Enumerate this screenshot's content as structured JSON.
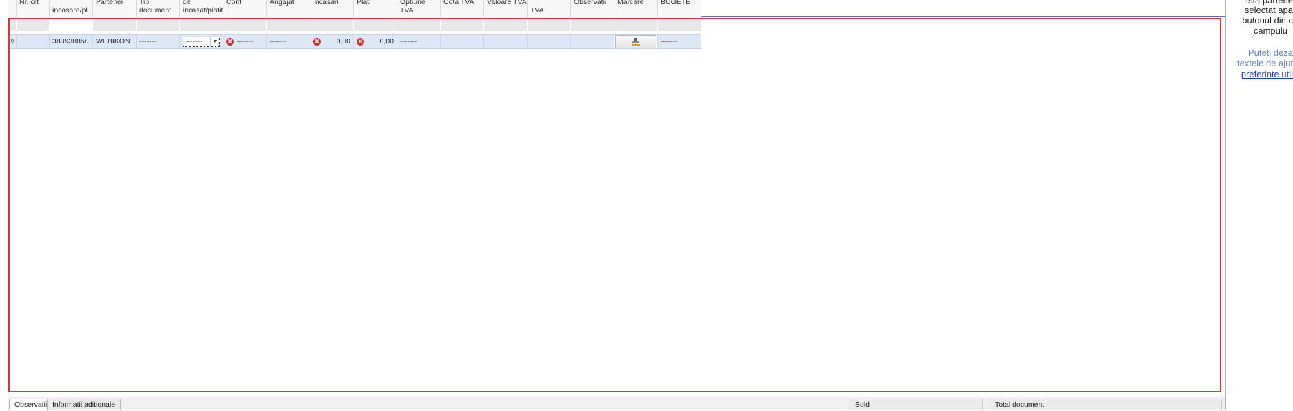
{
  "header": {
    "columns": [
      {
        "key": "nr",
        "l1": "Nr. crt",
        "l2": ""
      },
      {
        "key": "doc",
        "l1": "",
        "l2": "incasare/pl..."
      },
      {
        "key": "partener",
        "l1": "Partener",
        "l2": ""
      },
      {
        "key": "tipdoc",
        "l1": "Tip document",
        "l2": ""
      },
      {
        "key": "modalitate",
        "l1": "de",
        "l2": "incasat/platit"
      },
      {
        "key": "cont",
        "l1": "Cont",
        "l2": ""
      },
      {
        "key": "angajat",
        "l1": "Angajat",
        "l2": ""
      },
      {
        "key": "incasari",
        "l1": "Incasari",
        "l2": ""
      },
      {
        "key": "plati",
        "l1": "Plati",
        "l2": ""
      },
      {
        "key": "optiune",
        "l1": "Optiune TVA",
        "l2": ""
      },
      {
        "key": "cota",
        "l1": "Cota TVA",
        "l2": ""
      },
      {
        "key": "valoare",
        "l1": "Valoare TVA",
        "l2": ""
      },
      {
        "key": "tva",
        "l1": "",
        "l2": "TVA"
      },
      {
        "key": "obs",
        "l1": "Observatii",
        "l2": ""
      },
      {
        "key": "marcare",
        "l1": "Marcare",
        "l2": ""
      },
      {
        "key": "bugete",
        "l1": "BUGETE",
        "l2": ""
      }
    ]
  },
  "row": {
    "doc": "383938850",
    "partener": "WEBIKON ...",
    "tipdoc": "-------",
    "modalitate": "-------",
    "cont": "-------",
    "angajat": "-------",
    "incasari": "0,00",
    "plati": "0,00",
    "optiune": "-------",
    "bugete": "-------"
  },
  "bottom": {
    "tab_observatii": "Observatii",
    "tab_informatii": "Informatii aditionale",
    "sold": "Sold",
    "total": "Total document"
  },
  "help": {
    "l1": "lista partene",
    "l2": "selectat apa",
    "l3": "butonul din c",
    "l4": "campulu",
    "b1": "Puteti deza",
    "b2": "textele de ajut",
    "link": "preferinte util"
  },
  "colors": {
    "frame": "#e0303a",
    "selected_row": "#dde8f5",
    "error": "#d32a2a"
  },
  "icons": {
    "error": "error-x-icon",
    "mark": "stamp-icon",
    "dropdown": "chevron-down-icon"
  }
}
